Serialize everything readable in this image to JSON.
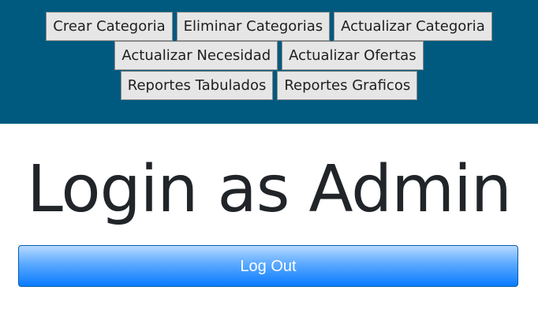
{
  "nav": {
    "row1": [
      "Crear Categoria",
      "Eliminar Categorias",
      "Actualizar Categoria"
    ],
    "row2": [
      "Actualizar Necesidad",
      "Actualizar Ofertas"
    ],
    "row3": [
      "Reportes Tabulados",
      "Reportes Graficos"
    ]
  },
  "main": {
    "title": "Login as Admin",
    "logout_label": "Log Out"
  },
  "colors": {
    "header_bg": "#005a7f",
    "logout_accent": "#0a7bff"
  }
}
